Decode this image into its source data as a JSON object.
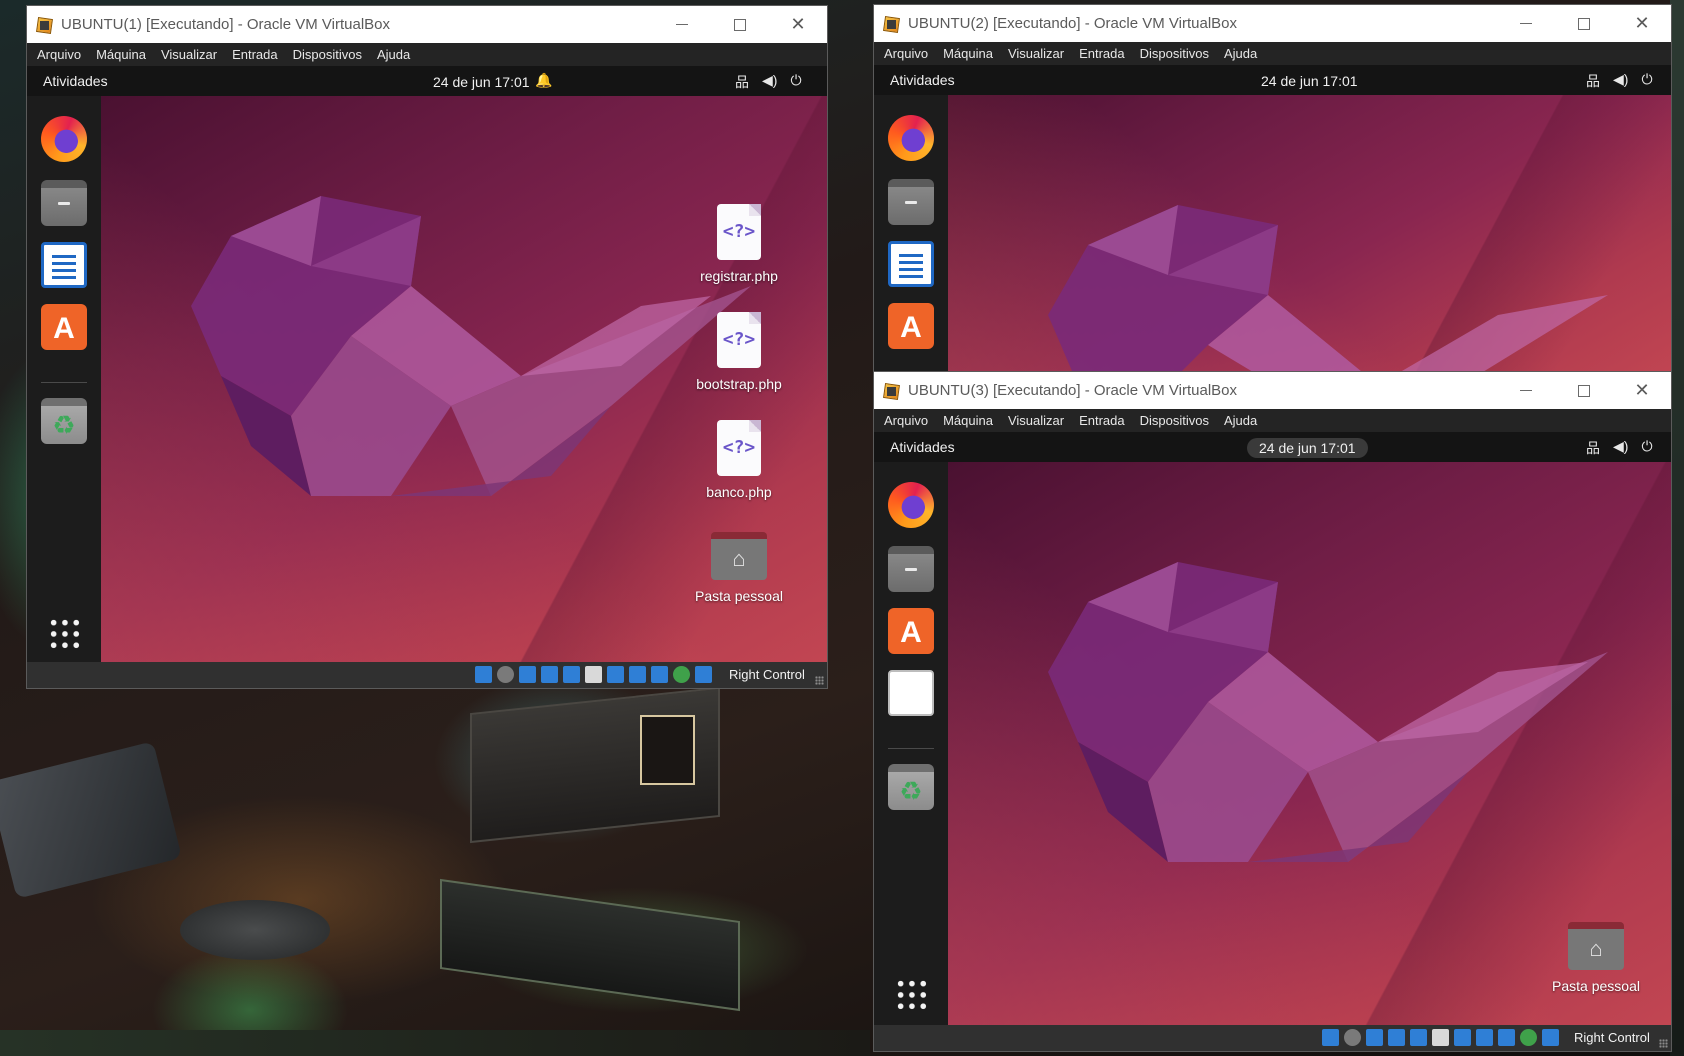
{
  "windows": [
    {
      "title": "UBUNTU(1) [Executando] - Oracle VM VirtualBox",
      "menu": [
        "Arquivo",
        "Máquina",
        "Visualizar",
        "Entrada",
        "Dispositivos",
        "Ajuda"
      ],
      "activities": "Atividades",
      "clock": "24 de jun  17:01",
      "desktop_icons": [
        {
          "label": "registrar.php",
          "icon": "php-file-icon"
        },
        {
          "label": "bootstrap.php",
          "icon": "php-file-icon"
        },
        {
          "label": "banco.php",
          "icon": "php-file-icon"
        },
        {
          "label": "Pasta pessoal",
          "icon": "home-folder-icon"
        }
      ],
      "host_key": "Right Control"
    },
    {
      "title": "UBUNTU(2) [Executando] - Oracle VM VirtualBox",
      "menu": [
        "Arquivo",
        "Máquina",
        "Visualizar",
        "Entrada",
        "Dispositivos",
        "Ajuda"
      ],
      "activities": "Atividades",
      "clock": "24 de jun  17:01"
    },
    {
      "title": "UBUNTU(3) [Executando] - Oracle VM VirtualBox",
      "menu": [
        "Arquivo",
        "Máquina",
        "Visualizar",
        "Entrada",
        "Dispositivos",
        "Ajuda"
      ],
      "activities": "Atividades",
      "clock": "24 de jun  17:01",
      "desktop_icons": [
        {
          "label": "Pasta pessoal",
          "icon": "home-folder-icon"
        }
      ],
      "host_key": "Right Control"
    }
  ],
  "icons": {
    "dock_vm1": [
      "firefox-icon",
      "files-icon",
      "libreoffice-writer-icon",
      "app-center-icon",
      "trash-icon",
      "show-apps-icon"
    ],
    "dock_vm2": [
      "firefox-icon",
      "files-icon",
      "libreoffice-writer-icon",
      "app-center-icon"
    ],
    "dock_vm3": [
      "firefox-icon",
      "files-icon",
      "app-center-icon",
      "text-document-icon",
      "trash-icon",
      "show-apps-icon"
    ],
    "tray": [
      "network-icon",
      "volume-icon",
      "power-icon"
    ],
    "titlebar": [
      "virtualbox-icon",
      "minimize-icon",
      "maximize-icon",
      "close-icon"
    ]
  },
  "glyphs": {
    "php": "<?>",
    "home": "⌂",
    "recycle": "♻",
    "store": "A",
    "bell": "🔔",
    "network": "品",
    "volume": "◀)",
    "power": "⏻",
    "close": "✕"
  },
  "colors": {
    "ubuntu_wallpaper": "#8a2650",
    "jellyfish": "#9a3a88",
    "gnome_bar": "#141414",
    "dock": "#1c1c1c",
    "vbox_menubar": "#242424",
    "vbox_statusbar": "#303030"
  }
}
